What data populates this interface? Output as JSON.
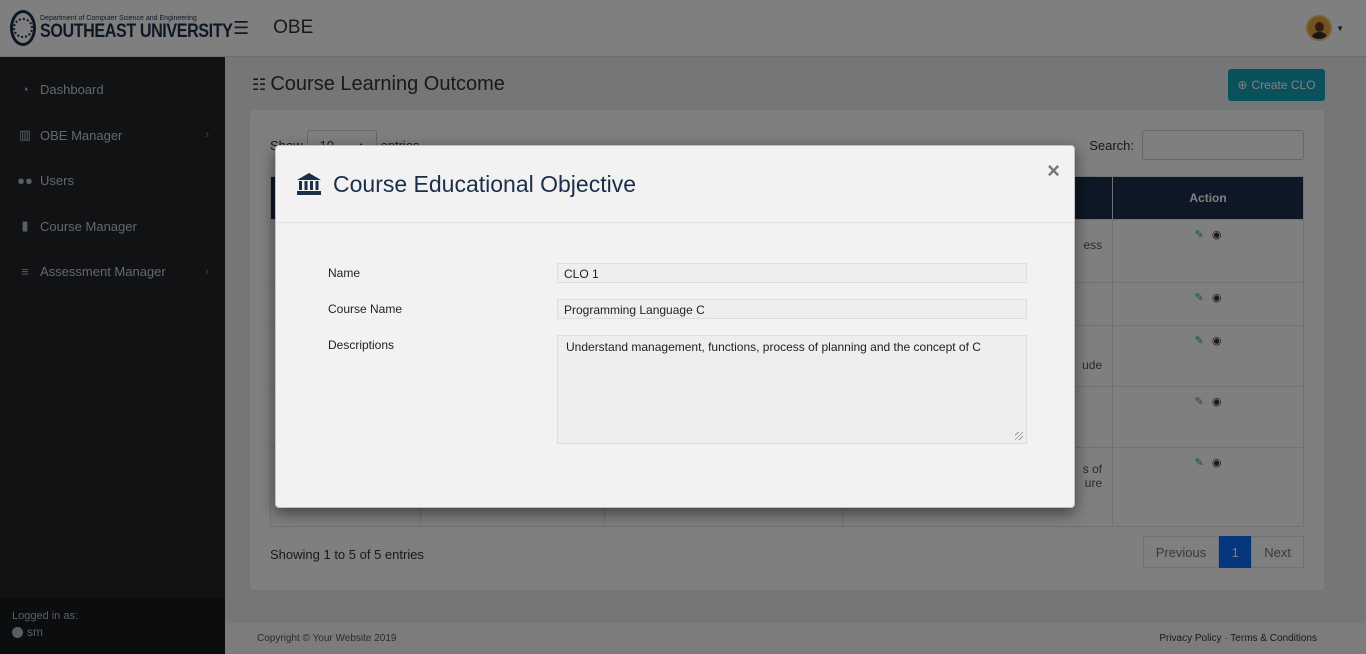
{
  "header": {
    "brand_dept": "Department of Computer Science and Engineering",
    "brand_name": "SOUTHEAST UNIVERSITY",
    "app_title": "OBE"
  },
  "sidebar": {
    "items": [
      {
        "label": "Dashboard",
        "icon": "tachometer-icon"
      },
      {
        "label": "OBE Manager",
        "icon": "columns-icon",
        "has_submenu": true
      },
      {
        "label": "Users",
        "icon": "users-icon"
      },
      {
        "label": "Course Manager",
        "icon": "briefcase-icon"
      },
      {
        "label": "Assessment Manager",
        "icon": "bars-icon",
        "has_submenu": true
      }
    ],
    "logged_in_label": "Logged in as:",
    "username": "sm"
  },
  "page": {
    "title": "Course Learning Outcome",
    "create_button": "Create CLO",
    "show_label": "Show",
    "entries_value": "10",
    "entries_label": "entries",
    "search_label": "Search:",
    "table_headers": [
      "",
      "",
      "",
      "",
      "",
      "Action"
    ],
    "table_fragments": [
      "ess",
      "",
      "ude",
      "",
      "s of\nure"
    ],
    "info": "Showing 1 to 5 of 5 entries",
    "pager": {
      "previous": "Previous",
      "current": "1",
      "next": "Next"
    }
  },
  "footer": {
    "copyright": "Copyright © Your Website 2019",
    "privacy": "Privacy Policy",
    "separator": "·",
    "terms": "Terms & Conditions"
  },
  "modal": {
    "title": "Course Educational Objective",
    "close_symbol": "×",
    "fields": {
      "name_label": "Name",
      "name_value": "CLO 1",
      "course_label": "Course Name",
      "course_value": "Programming Language C",
      "desc_label": "Descriptions",
      "desc_value": "Understand management, functions, process of planning and the concept of C"
    }
  },
  "colors": {
    "navy": "#1c2e4a",
    "sidebar": "#212529",
    "accent": "#17a2b8",
    "primary": "#0d6efd"
  }
}
